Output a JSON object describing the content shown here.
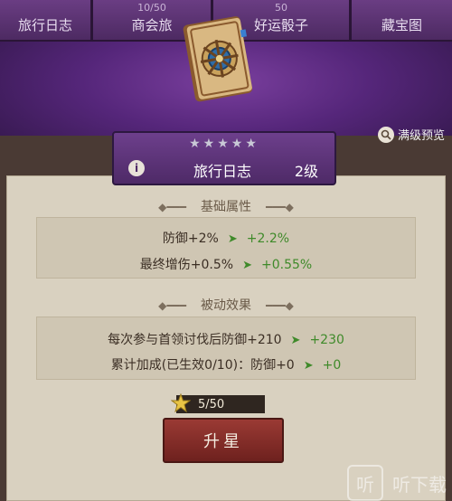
{
  "tabs": [
    {
      "label": "旅行日志",
      "count": ""
    },
    {
      "label": "商会旅",
      "count": "10/50"
    },
    {
      "label": "好运骰子",
      "count": "50"
    },
    {
      "label": "藏宝图",
      "count": ""
    }
  ],
  "preview": {
    "label": "满级预览",
    "icon": "magnifier-icon"
  },
  "item": {
    "stars": "★★★★★",
    "name": "旅行日志",
    "level": "2级",
    "info_icon": "i"
  },
  "basic": {
    "title": "基础属性",
    "rows": [
      {
        "label": "防御+2%",
        "gain": "+2.2%"
      },
      {
        "label": "最终增伤+0.5%",
        "gain": "+0.55%"
      }
    ]
  },
  "passive": {
    "title": "被动效果",
    "rows": [
      {
        "label": "每次参与首领讨伐后防御+210",
        "gain": "+230"
      },
      {
        "label": "累计加成(已生效0/10)：防御+0",
        "gain": "+0"
      }
    ]
  },
  "cost": {
    "value": "5/50"
  },
  "upgrade_button": {
    "label": "升星"
  },
  "watermark": {
    "glyph": "听",
    "text": "听下载"
  }
}
